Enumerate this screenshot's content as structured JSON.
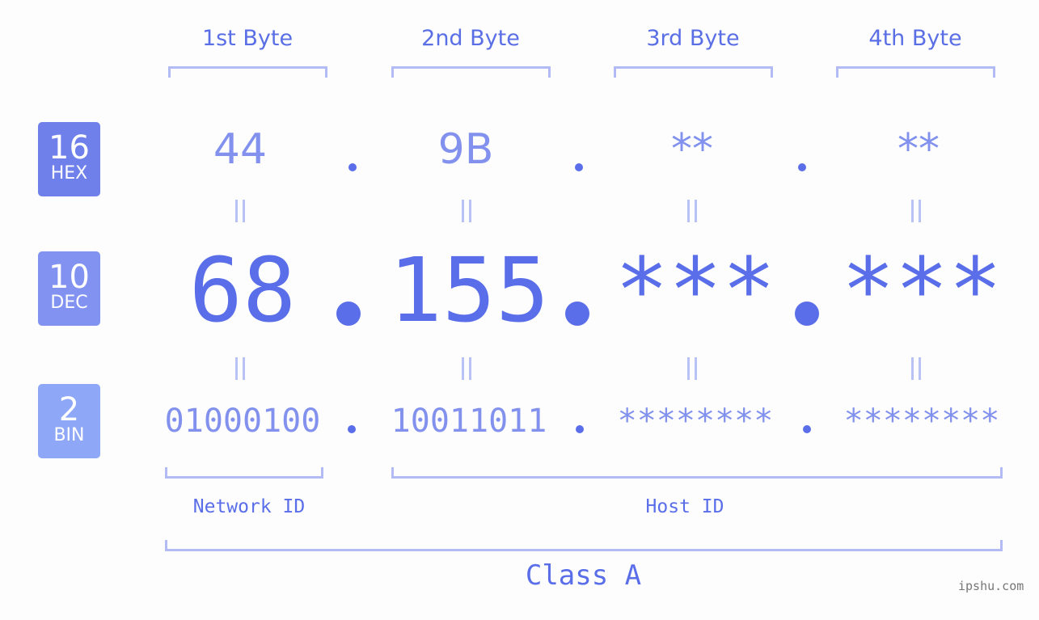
{
  "headers": [
    "1st Byte",
    "2nd Byte",
    "3rd Byte",
    "4th Byte"
  ],
  "badges": {
    "hex": {
      "num": "16",
      "label": "HEX",
      "color": "#6f80ea"
    },
    "dec": {
      "num": "10",
      "label": "DEC",
      "color": "#8192f0"
    },
    "bin": {
      "num": "2",
      "label": "BIN",
      "color": "#8ea7f6"
    }
  },
  "hex": [
    "44",
    "9B",
    "**",
    "**"
  ],
  "dec": [
    "68",
    "155",
    "***",
    "***"
  ],
  "bin": [
    "01000100",
    "10011011",
    "********",
    "********"
  ],
  "separator": ".",
  "network_id_label": "Network ID",
  "host_id_label": "Host ID",
  "class_label": "Class A",
  "watermark": "ipshu.com",
  "colors": {
    "primary": "#5a6ee9",
    "light": "#8291ee",
    "bracket": "#b2bbf4"
  }
}
